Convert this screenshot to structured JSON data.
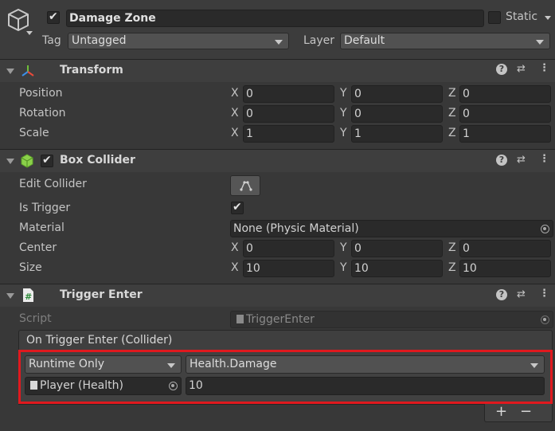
{
  "gameobject": {
    "active_checked": true,
    "name": "Damage Zone",
    "static_label": "Static",
    "tag_label": "Tag",
    "tag_value": "Untagged",
    "layer_label": "Layer",
    "layer_value": "Default"
  },
  "transform": {
    "title": "Transform",
    "position_label": "Position",
    "rotation_label": "Rotation",
    "scale_label": "Scale",
    "axis_x": "X",
    "axis_y": "Y",
    "axis_z": "Z",
    "position": {
      "x": "0",
      "y": "0",
      "z": "0"
    },
    "rotation": {
      "x": "0",
      "y": "0",
      "z": "0"
    },
    "scale": {
      "x": "1",
      "y": "1",
      "z": "1"
    }
  },
  "box_collider": {
    "title": "Box Collider",
    "edit_collider_label": "Edit Collider",
    "is_trigger_label": "Is Trigger",
    "is_trigger_checked": true,
    "material_label": "Material",
    "material_value": "None (Physic Material)",
    "center_label": "Center",
    "size_label": "Size",
    "center": {
      "x": "0",
      "y": "0",
      "z": "0"
    },
    "size": {
      "x": "10",
      "y": "10",
      "z": "10"
    }
  },
  "trigger_enter": {
    "title": "Trigger Enter",
    "script_label": "Script",
    "script_value": "TriggerEnter",
    "event_header": "On Trigger Enter (Collider)",
    "runtime_value": "Runtime Only",
    "function_value": "Health.Damage",
    "target_value": "Player (Health)",
    "argument_value": "10",
    "add_label": "+",
    "remove_label": "−"
  },
  "colors": {
    "background": "#383838",
    "highlight_border": "#e0191e",
    "field": "#2a2a2a"
  },
  "icons": [
    "gameobject-cube-icon",
    "transform-axes-icon",
    "box-collider-cube-icon",
    "script-icon",
    "help-icon",
    "presets-icon",
    "menu-dots-icon",
    "object-picker-icon",
    "edit-collider-icon"
  ]
}
